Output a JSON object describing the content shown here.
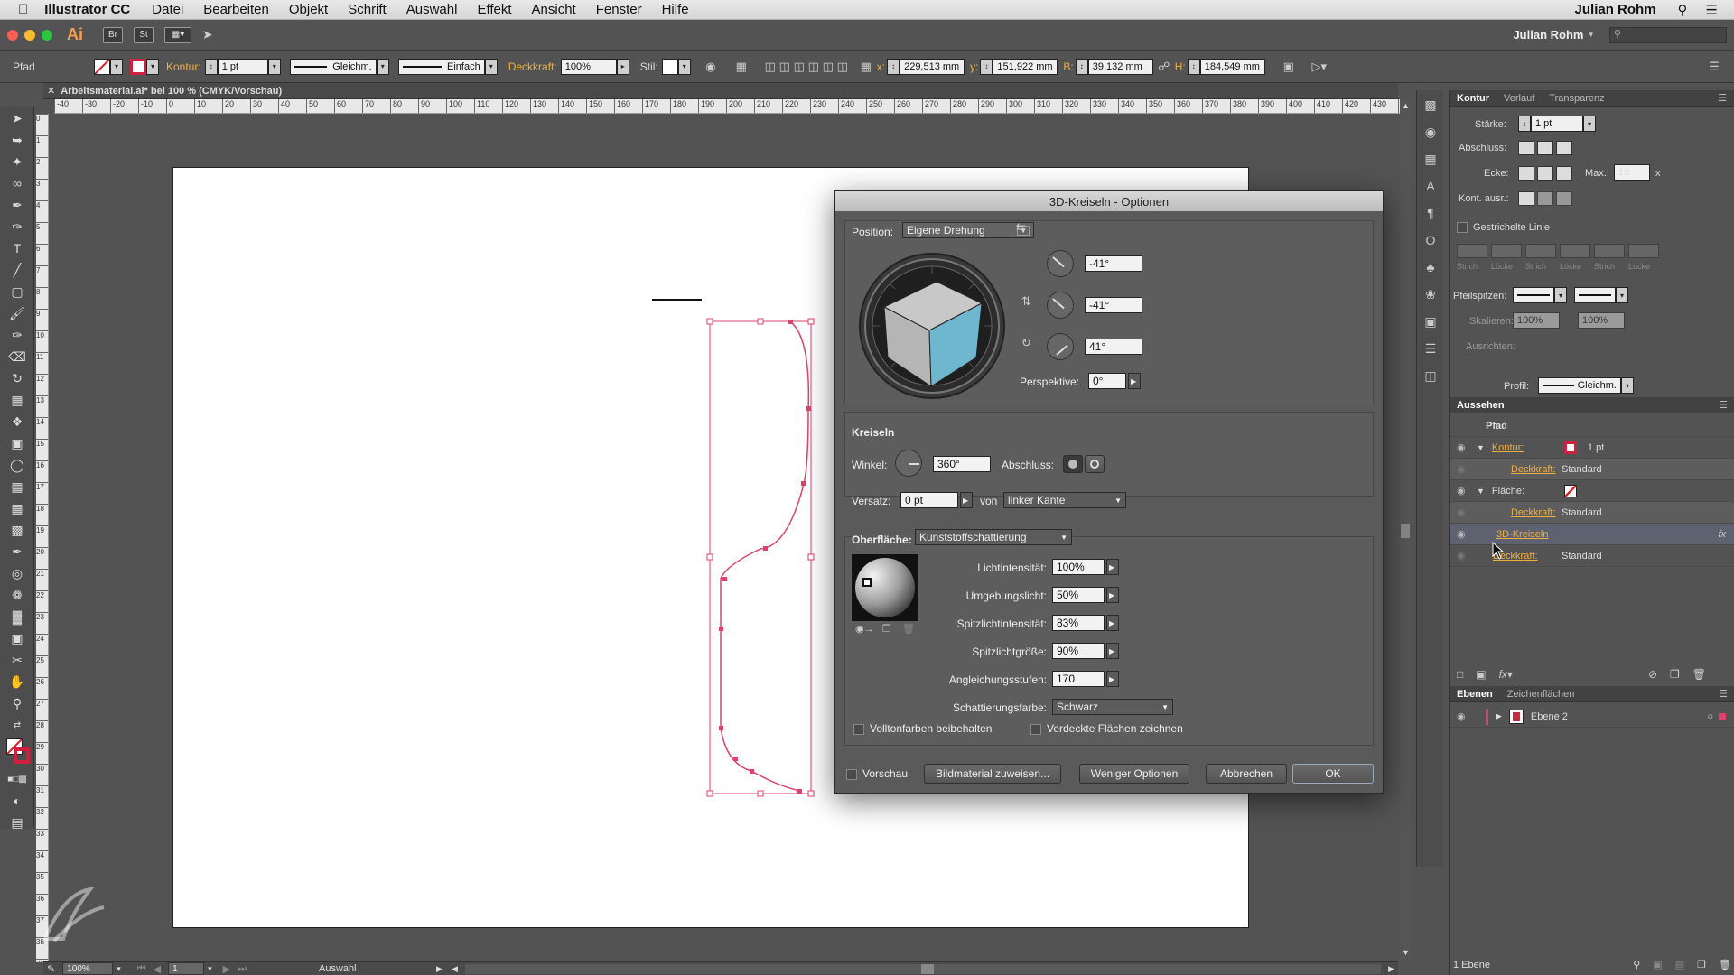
{
  "menubar": {
    "app": "Illustrator CC",
    "items": [
      "Datei",
      "Bearbeiten",
      "Objekt",
      "Schrift",
      "Auswahl",
      "Effekt",
      "Ansicht",
      "Fenster",
      "Hilfe"
    ],
    "user": "Julian Rohm"
  },
  "appbar": {
    "logo": "Ai",
    "br": "Br",
    "st": "St",
    "workspace_user": "Julian Rohm"
  },
  "control": {
    "object_type": "Pfad",
    "kontur_label": "Kontur:",
    "kontur_value": "1 pt",
    "stroke_profile": "Gleichm.",
    "brush": "Einfach",
    "opacity_label": "Deckkraft:",
    "opacity_value": "100%",
    "style_label": "Stil:",
    "x_label": "x:",
    "x_value": "229,513 mm",
    "y_label": "y:",
    "y_value": "151,922 mm",
    "w_label": "B:",
    "w_value": "39,132 mm",
    "h_label": "H:",
    "h_value": "184,549 mm"
  },
  "document": {
    "tab_title": "Arbeitsmaterial.ai* bei 100 % (CMYK/Vorschau)"
  },
  "status": {
    "zoom": "100%",
    "page": "1",
    "tool": "Auswahl"
  },
  "stroke_panel": {
    "tabs": [
      "Kontur",
      "Verlauf",
      "Transparenz"
    ],
    "weight_label": "Stärke:",
    "weight_value": "1 pt",
    "cap_label": "Abschluss:",
    "corner_label": "Ecke:",
    "limit_label": "Max.:",
    "limit_value": "10",
    "align_label": "Kont. ausr.:",
    "dashed_label": "Gestrichelte Linie",
    "dash_labels": [
      "Strich",
      "Lücke",
      "Strich",
      "Lücke",
      "Strich",
      "Lücke"
    ],
    "arrow_label": "Pfeilspitzen:",
    "scale_label": "Skalieren:",
    "scale_a": "100%",
    "scale_b": "100%",
    "align2_label": "Ausrichten:",
    "profile_label": "Profil:",
    "profile_value": "Gleichm."
  },
  "appearance_panel": {
    "title": "Aussehen",
    "object": "Pfad",
    "rows": [
      {
        "label": "Kontur:",
        "value": "1 pt"
      },
      {
        "label": "Deckkraft:",
        "value": "Standard"
      },
      {
        "label": "Fläche:",
        "value": ""
      },
      {
        "label": "Deckkraft:",
        "value": "Standard"
      },
      {
        "label": "3D-Kreiseln",
        "value": "fx"
      },
      {
        "label": "Deckkraft:",
        "value": "Standard"
      }
    ]
  },
  "layers_panel": {
    "tabs": [
      "Ebenen",
      "Zeichenflächen"
    ],
    "layer": "Ebene 2",
    "footer": "1 Ebene"
  },
  "dialog": {
    "title": "3D-Kreiseln - Optionen",
    "position_label": "Position:",
    "position_value": "Eigene Drehung",
    "rot_x": "-41°",
    "rot_y": "-41°",
    "rot_z": "41°",
    "perspective_label": "Perspektive:",
    "perspective_value": "0°",
    "revolve_title": "Kreiseln",
    "angle_label": "Winkel:",
    "angle_value": "360°",
    "cap_label": "Abschluss:",
    "offset_label": "Versatz:",
    "offset_value": "0 pt",
    "from_label": "von",
    "from_value": "linker Kante",
    "surface_label": "Oberfläche:",
    "surface_value": "Kunststoffschattierung",
    "light_intensity_label": "Lichtintensität:",
    "light_intensity_value": "100%",
    "ambient_label": "Umgebungslicht:",
    "ambient_value": "50%",
    "highlight_intensity_label": "Spitzlichtintensität:",
    "highlight_intensity_value": "83%",
    "highlight_size_label": "Spitzlichtgröße:",
    "highlight_size_value": "90%",
    "blend_steps_label": "Angleichungsstufen:",
    "blend_steps_value": "170",
    "shading_color_label": "Schattierungsfarbe:",
    "shading_color_value": "Schwarz",
    "preserve_spot_label": "Volltonfarben beibehalten",
    "draw_hidden_label": "Verdeckte Flächen zeichnen",
    "preview_label": "Vorschau",
    "map_art_btn": "Bildmaterial zuweisen...",
    "fewer_btn": "Weniger Optionen",
    "cancel_btn": "Abbrechen",
    "ok_btn": "OK"
  },
  "colors": {
    "accent": "#e0406a",
    "cube_face": "#6fb6cf",
    "orange_label": "#f0b040"
  }
}
